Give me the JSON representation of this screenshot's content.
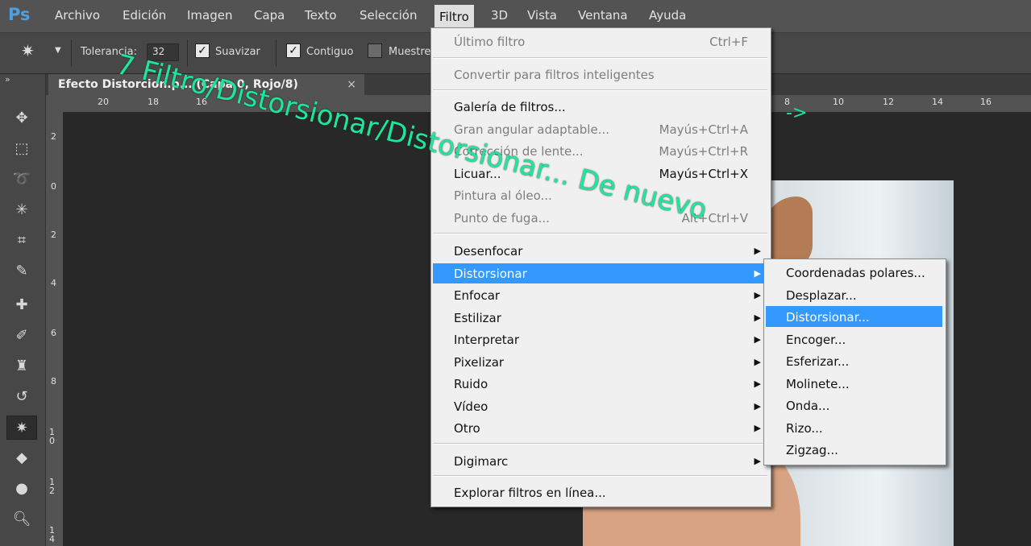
{
  "app": {
    "logo": "Ps"
  },
  "menubar": {
    "items": [
      "Archivo",
      "Edición",
      "Imagen",
      "Capa",
      "Texto",
      "Selección",
      "Filtro",
      "3D",
      "Vista",
      "Ventana",
      "Ayuda"
    ],
    "active": "Filtro"
  },
  "options": {
    "tolerance_label": "Tolerancia:",
    "tolerance_value": "32",
    "antialias_label": "Suavizar",
    "contiguous_label": "Contiguo",
    "sample_label": "Muestre"
  },
  "document": {
    "tab_title": "Efecto Distorcion.p... (Capa 0, Rojo/8)",
    "close_label": "×"
  },
  "rulers": {
    "horizontal": [
      "20",
      "18",
      "16",
      "8",
      "10",
      "12",
      "14",
      "16"
    ],
    "vertical": [
      "2",
      "0",
      "2",
      "4",
      "6",
      "8",
      "1 0",
      "1 2",
      "1 4"
    ]
  },
  "filter_menu": {
    "items": [
      {
        "label": "Último filtro",
        "shortcut": "Ctrl+F",
        "disabled": true
      },
      {
        "label": "Convertir para filtros inteligentes",
        "disabled": true
      },
      {
        "label": "Galería de filtros...",
        "disabled": false
      },
      {
        "label": "Gran angular adaptable...",
        "shortcut": "Mayús+Ctrl+A",
        "disabled": true
      },
      {
        "label": "Corrección de lente...",
        "shortcut": "Mayús+Ctrl+R",
        "disabled": true
      },
      {
        "label": "Licuar...",
        "shortcut": "Mayús+Ctrl+X",
        "disabled": false
      },
      {
        "label": "Pintura al óleo...",
        "disabled": true
      },
      {
        "label": "Punto de fuga...",
        "shortcut": "Alt+Ctrl+V",
        "disabled": true
      },
      {
        "label": "Desenfocar",
        "submenu": true
      },
      {
        "label": "Distorsionar",
        "submenu": true,
        "highlighted": true
      },
      {
        "label": "Enfocar",
        "submenu": true
      },
      {
        "label": "Estilizar",
        "submenu": true
      },
      {
        "label": "Interpretar",
        "submenu": true
      },
      {
        "label": "Pixelizar",
        "submenu": true
      },
      {
        "label": "Ruido",
        "submenu": true
      },
      {
        "label": "Vídeo",
        "submenu": true
      },
      {
        "label": "Otro",
        "submenu": true
      },
      {
        "label": "Digimarc",
        "submenu": true
      },
      {
        "label": "Explorar filtros en línea..."
      }
    ]
  },
  "distort_submenu": {
    "items": [
      "Coordenadas polares...",
      "Desplazar...",
      "Distorsionar...",
      "Encoger...",
      "Esferizar...",
      "Molinete...",
      "Onda...",
      "Rizo...",
      "Zigzag..."
    ],
    "highlighted": "Distorsionar..."
  },
  "annotation": {
    "text": "7 Filtro/Distorsionar/Distorsionar... De nuevo",
    "arrow": "->",
    "color": "#1ee69a"
  },
  "tools": [
    "move-tool-icon",
    "marquee-tool-icon",
    "lasso-tool-icon",
    "magic-wand-icon",
    "crop-tool-icon",
    "eyedropper-icon",
    "healing-brush-icon",
    "brush-tool-icon",
    "stamp-tool-icon",
    "history-brush-icon",
    "eraser-tool-icon",
    "paint-bucket-icon",
    "blur-tool-icon",
    "dodge-tool-icon"
  ]
}
